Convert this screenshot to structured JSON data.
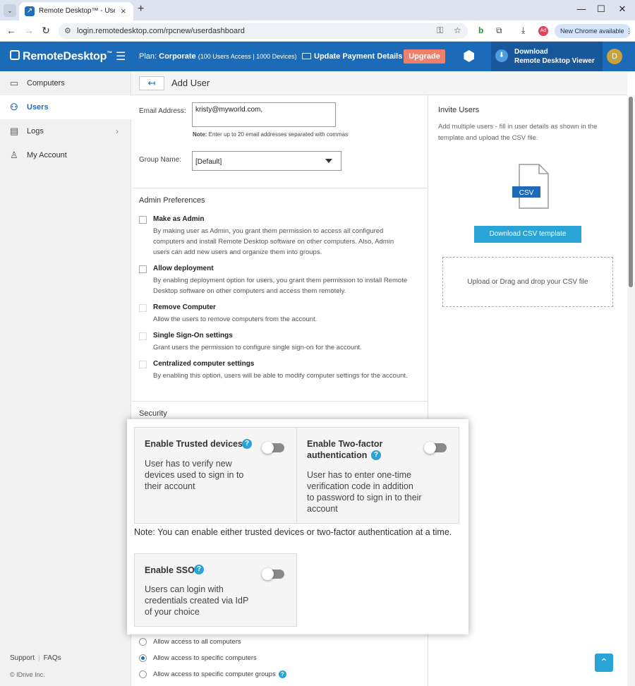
{
  "browser": {
    "tab_title": "Remote Desktop™ - User Mana",
    "url": "login.remotedesktop.com/rpcnew/userdashboard",
    "chrome_available": "New Chrome available"
  },
  "header": {
    "logo": "RemoteDesktop",
    "logo_tm": "™",
    "plan_label": "Plan:",
    "plan_name": "Corporate",
    "plan_detail": "(100 Users Access | 1000 Devices)",
    "payment": "Update Payment Details",
    "upgrade": "Upgrade",
    "download_line1": "Download",
    "download_line2": "Remote Desktop Viewer",
    "avatar": "D"
  },
  "sidebar": {
    "items": [
      {
        "label": "Computers"
      },
      {
        "label": "Users"
      },
      {
        "label": "Logs"
      },
      {
        "label": "My Account"
      }
    ],
    "support": "Support",
    "faqs": "FAQs",
    "copyright": "© IDrive Inc."
  },
  "page": {
    "back": "↤",
    "title": "Add User"
  },
  "form": {
    "email_label": "Email Address:",
    "email_value": "kristy@myworld.com,",
    "note_bold": "Note:",
    "note_text": " Enter up to 20 email addresses separated with commas",
    "group_label": "Group Name:",
    "group_value": "[Default]",
    "admin_prefs_title": "Admin Preferences",
    "prefs": [
      {
        "title": "Make as Admin",
        "desc": "By making user as Admin, you grant them permission to access all configured computers and install Remote Desktop software on other computers. Also, Admin users can add new users and organize them into groups."
      },
      {
        "title": "Allow deployment",
        "desc": "By enabling deployment option for users, you grant them permission to install Remote Desktop software on other computers and access them remotely."
      },
      {
        "title": "Remove Computer",
        "desc": "Allow the users to remove computers from the account."
      },
      {
        "title": "Single Sign-On settings",
        "desc": "Grant users the permission to configure single sign-on for the account."
      },
      {
        "title": "Centralized computer settings",
        "desc": "By enabling this option, users will be able to modify computer settings for the account."
      }
    ],
    "security_title": "Security",
    "access": [
      {
        "label": "Allow access to all computers",
        "selected": false
      },
      {
        "label": "Allow access to specific computers",
        "selected": true
      },
      {
        "label": "Allow access to specific computer groups",
        "selected": false
      }
    ]
  },
  "security": {
    "trusted_title": "Enable Trusted devices",
    "trusted_desc": "User has to verify new devices used to sign in to their account",
    "twofa_title": "Enable Two-factor authentication",
    "twofa_desc": "User has to enter one-time verification code in addition to password to sign in to their account",
    "note": "Note: You can enable either trusted devices or two-factor authentication at a time.",
    "sso_title": "Enable SSO",
    "sso_desc": "Users can login with credentials created via IdP of your choice"
  },
  "invite": {
    "title": "Invite Users",
    "desc": "Add multiple users - fill in user details as shown in the template and upload the CSV file.",
    "csv_label": "CSV",
    "download_btn": "Download CSV template",
    "dropzone": "Upload or Drag and drop your CSV file"
  },
  "colors": {
    "brand": "#1c6bb8",
    "accent": "#2aa3d6",
    "upgrade": "#f07f6b"
  }
}
